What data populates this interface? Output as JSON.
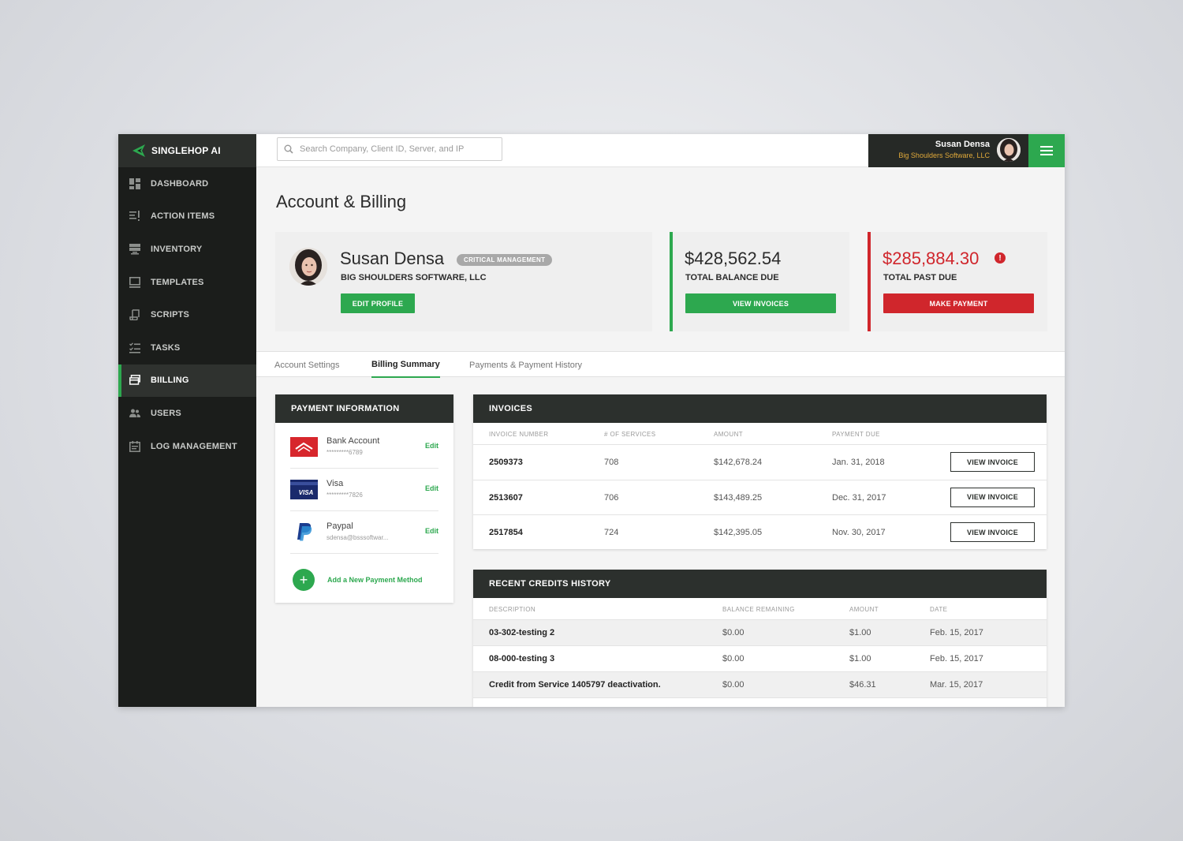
{
  "brand": {
    "name": "SINGLEHOP AI",
    "accent": "#2da84f"
  },
  "sidebar": {
    "items": [
      {
        "label": "DASHBOARD",
        "icon": "dashboard-icon"
      },
      {
        "label": "ACTION ITEMS",
        "icon": "action-items-icon"
      },
      {
        "label": "INVENTORY",
        "icon": "inventory-icon"
      },
      {
        "label": "TEMPLATES",
        "icon": "templates-icon"
      },
      {
        "label": "SCRIPTS",
        "icon": "scripts-icon"
      },
      {
        "label": "TASKS",
        "icon": "tasks-icon"
      },
      {
        "label": "BIILLING",
        "icon": "billing-icon",
        "active": true
      },
      {
        "label": "USERS",
        "icon": "users-icon"
      },
      {
        "label": "LOG MANAGEMENT",
        "icon": "log-management-icon"
      }
    ]
  },
  "header": {
    "search_placeholder": "Search Company, Client ID, Server, and IP",
    "user_name": "Susan Densa",
    "user_company": "Big Shoulders Software, LLC"
  },
  "page": {
    "title": "Account & Billing"
  },
  "profile": {
    "name": "Susan Densa",
    "badge": "CRITICAL MANAGEMENT",
    "company": "BIG SHOULDERS SOFTWARE, LLC",
    "edit_label": "EDIT PROFILE"
  },
  "balance": {
    "amount": "$428,562.54",
    "label": "TOTAL BALANCE DUE",
    "button": "VIEW INVOICES"
  },
  "past_due": {
    "amount": "$285,884.30",
    "label": "TOTAL PAST DUE",
    "button": "MAKE PAYMENT",
    "alert_glyph": "!"
  },
  "tabs": [
    {
      "label": "Account Settings"
    },
    {
      "label": "Billing Summary",
      "active": true
    },
    {
      "label": "Payments & Payment History"
    }
  ],
  "payment_info": {
    "title": "PAYMENT INFORMATION",
    "methods": [
      {
        "name": "Bank Account",
        "detail": "*********6789",
        "edit": "Edit",
        "icon": "bank-logo-icon"
      },
      {
        "name": "Visa",
        "detail": "*********7826",
        "edit": "Edit",
        "icon": "visa-logo-icon",
        "logo_text": "VISA"
      },
      {
        "name": "Paypal",
        "detail": "sdensa@bsssoftwar...",
        "edit": "Edit",
        "icon": "paypal-logo-icon"
      }
    ],
    "add_label": "Add a New Payment Method",
    "add_glyph": "+"
  },
  "invoices": {
    "title": "INVOICES",
    "columns": [
      "INVOICE NUMBER",
      "# OF SERVICES",
      "AMOUNT",
      "PAYMENT DUE"
    ],
    "button_label": "VIEW INVOICE",
    "rows": [
      {
        "number": "2509373",
        "services": "708",
        "amount": "$142,678.24",
        "due": "Jan. 31, 2018"
      },
      {
        "number": "2513607",
        "services": "706",
        "amount": "$143,489.25",
        "due": "Dec. 31, 2017"
      },
      {
        "number": "2517854",
        "services": "724",
        "amount": "$142,395.05",
        "due": "Nov. 30, 2017"
      }
    ]
  },
  "credits": {
    "title": "RECENT CREDITS HISTORY",
    "columns": [
      "DESCRIPTION",
      "BALANCE REMAINING",
      "AMOUNT",
      "DATE"
    ],
    "rows": [
      {
        "description": "03-302-testing 2",
        "balance": "$0.00",
        "amount": "$1.00",
        "date": "Feb. 15, 2017"
      },
      {
        "description": "08-000-testing 3",
        "balance": "$0.00",
        "amount": "$1.00",
        "date": "Feb. 15, 2017"
      },
      {
        "description": "Credit from Service 1405797 deactivation.",
        "balance": "$0.00",
        "amount": "$46.31",
        "date": "Mar. 15, 2017"
      }
    ]
  }
}
